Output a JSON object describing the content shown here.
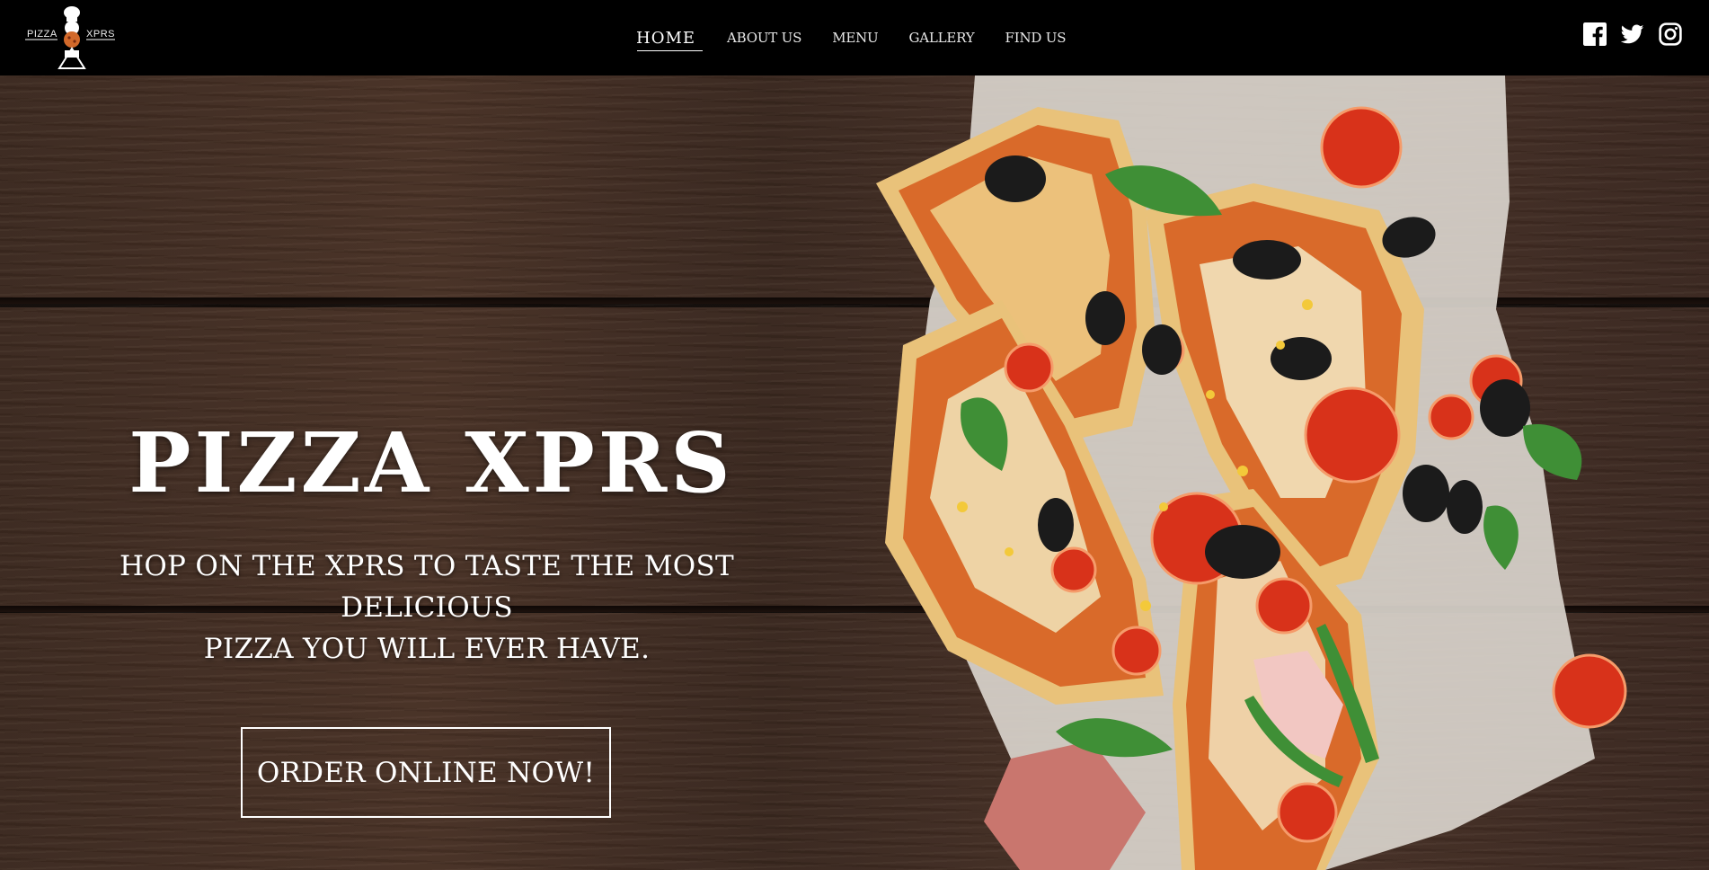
{
  "brand": {
    "logo_left": "PIZZA",
    "logo_right": "XPRS"
  },
  "nav": {
    "items": [
      {
        "label": "HOME",
        "active": true
      },
      {
        "label": "ABOUT US",
        "active": false
      },
      {
        "label": "MENU",
        "active": false
      },
      {
        "label": "GALLERY",
        "active": false
      },
      {
        "label": "FIND US",
        "active": false
      }
    ]
  },
  "social": [
    {
      "icon": "facebook-icon"
    },
    {
      "icon": "twitter-icon"
    },
    {
      "icon": "instagram-icon"
    }
  ],
  "hero": {
    "title": "PIZZA XPRS",
    "subtitle_line1": "HOP ON THE XPRS TO TASTE THE MOST DELICIOUS",
    "subtitle_line2": "PIZZA YOU WILL EVER HAVE.",
    "cta_label": "ORDER ONLINE NOW!"
  },
  "colors": {
    "header_bg": "#000000",
    "wood": "#3d2a20",
    "text": "#ffffff"
  }
}
